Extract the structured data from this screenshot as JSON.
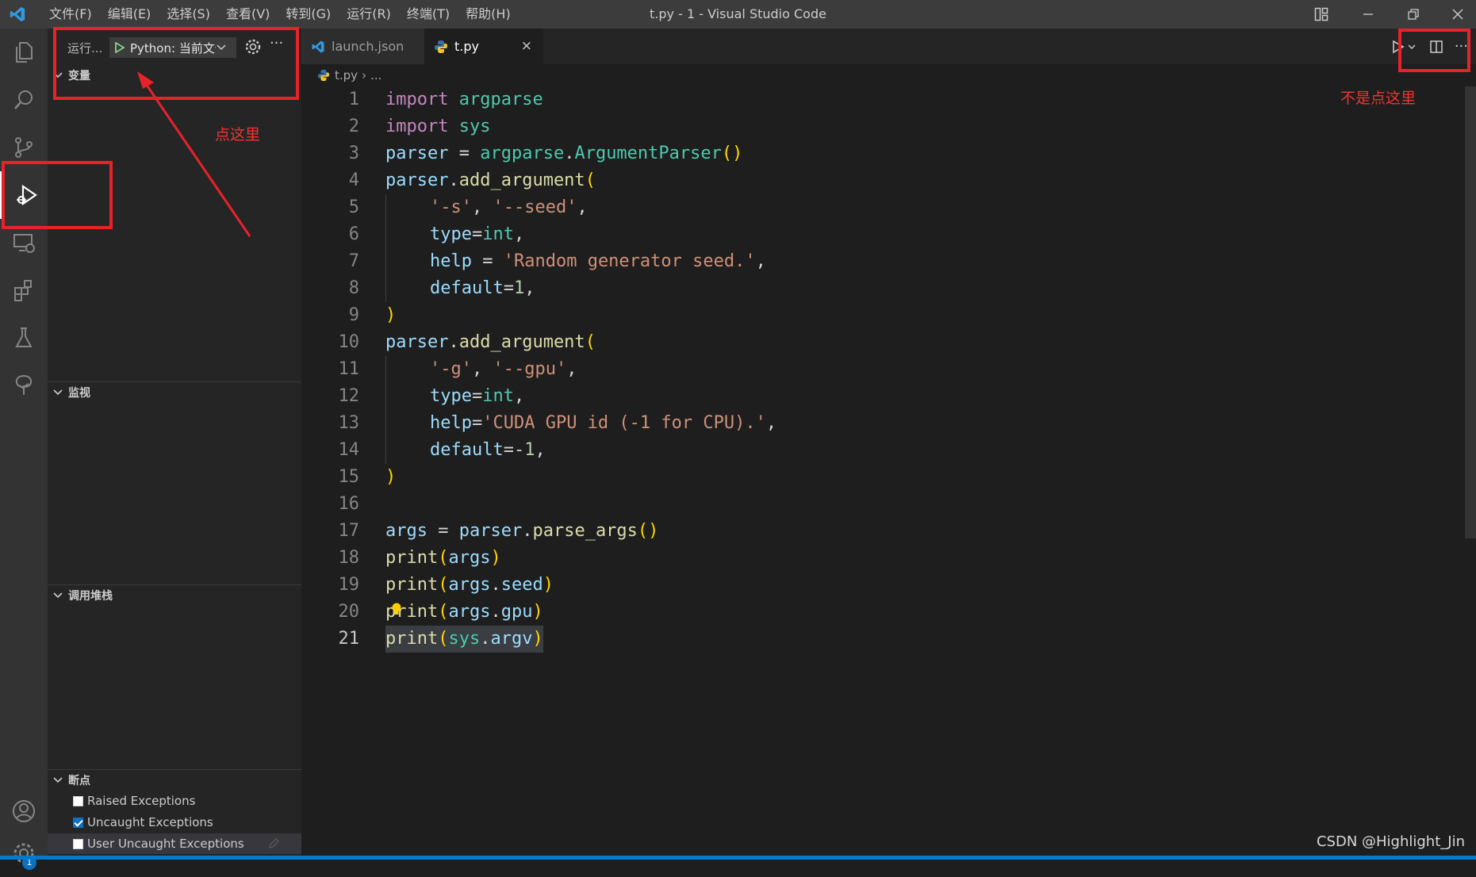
{
  "window": {
    "title": "t.py - 1 - Visual Studio Code",
    "menu": [
      "文件(F)",
      "编辑(E)",
      "选择(S)",
      "查看(V)",
      "转到(G)",
      "运行(R)",
      "终端(T)",
      "帮助(H)"
    ]
  },
  "activity_bar": {
    "items": [
      "explorer-icon",
      "search-icon",
      "source-control-icon",
      "run-debug-icon",
      "remote-explorer-icon",
      "extensions-icon",
      "testing-icon",
      "tree-icon"
    ],
    "active": "run-debug-icon",
    "bottom": [
      "account-icon",
      "manage-gear-icon"
    ],
    "manage_badge": "1"
  },
  "sidebar": {
    "run_label": "运行...",
    "config_name": "Python: 当前文件",
    "sections": {
      "variables": "变量",
      "watch": "监视",
      "call_stack": "调用堆栈",
      "breakpoints": "断点"
    },
    "breakpoints": [
      {
        "label": "Raised Exceptions",
        "checked": false
      },
      {
        "label": "Uncaught Exceptions",
        "checked": true
      },
      {
        "label": "User Uncaught Exceptions",
        "checked": false
      }
    ]
  },
  "tabs": [
    {
      "label": "launch.json",
      "active": false
    },
    {
      "label": "t.py",
      "active": true,
      "close": "×"
    }
  ],
  "breadcrumb": {
    "file": "t.py",
    "separator": "›",
    "rest": "..."
  },
  "code": {
    "line_numbers": [
      "1",
      "2",
      "3",
      "4",
      "5",
      "6",
      "7",
      "8",
      "9",
      "10",
      "11",
      "12",
      "13",
      "14",
      "15",
      "16",
      "17",
      "18",
      "19",
      "20",
      "21"
    ],
    "current_line": "21"
  },
  "annotations": {
    "click_here": "点这里",
    "not_here": "不是点这里"
  },
  "watermark": "CSDN @Highlight_Jin",
  "colors": {
    "annotation_red": "#e8222a",
    "accent_blue": "#007acc"
  }
}
